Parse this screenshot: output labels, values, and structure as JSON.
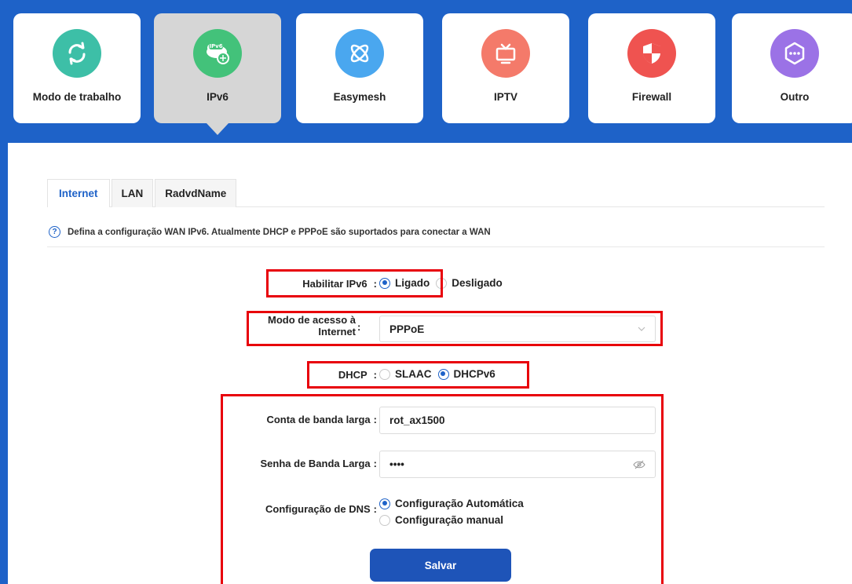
{
  "categories": [
    {
      "label": "Modo de trabalho",
      "icon": "sync-icon",
      "color": "#3dbfa7"
    },
    {
      "label": "IPv6",
      "icon": "ipv6-icon",
      "color": "#43c27a",
      "active": true
    },
    {
      "label": "Easymesh",
      "icon": "mesh-icon",
      "color": "#4aa7ef"
    },
    {
      "label": "IPTV",
      "icon": "tv-icon",
      "color": "#f47a6a"
    },
    {
      "label": "Firewall",
      "icon": "shield-icon",
      "color": "#ef5350"
    },
    {
      "label": "Outro",
      "icon": "more-icon",
      "color": "#9b72e6"
    }
  ],
  "ipv6_badge": "IPv6",
  "tabs": [
    {
      "label": "Internet",
      "active": true
    },
    {
      "label": "LAN"
    },
    {
      "label": "RadvdName"
    }
  ],
  "help_text": "Defina a configuração WAN IPv6. Atualmente DHCP e PPPoE são suportados para conectar a WAN",
  "form": {
    "enable_label": "Habilitar IPv6",
    "enable_on": "Ligado",
    "enable_off": "Desligado",
    "access_label_line1": "Modo de acesso à",
    "access_label_line2": "Internet",
    "access_value": "PPPoE",
    "dhcp_label": "DHCP",
    "dhcp_slaac": "SLAAC",
    "dhcp_dhcpv6": "DHCPv6",
    "account_label": "Conta de banda larga",
    "account_value": "rot_ax1500",
    "password_label": "Senha de Banda Larga",
    "password_value": "••••",
    "dns_label": "Configuração de DNS",
    "dns_auto": "Configuração Automática",
    "dns_manual": "Configuração manual",
    "colon": ":",
    "save_label": "Salvar"
  },
  "colors": {
    "accent": "#1e62c8",
    "highlight": "#e8000a"
  }
}
